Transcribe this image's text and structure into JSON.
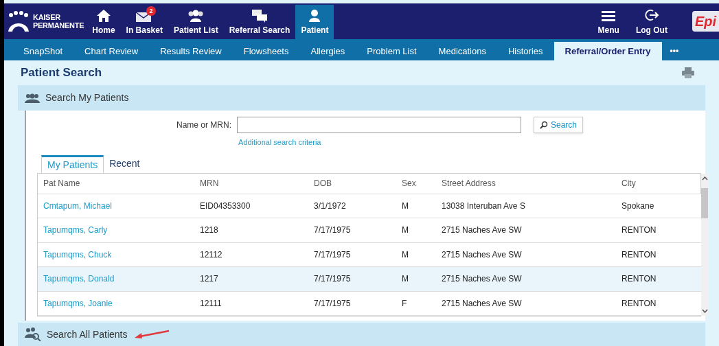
{
  "header": {
    "logo_text": [
      "KAISER",
      "PERMANENTE"
    ],
    "nav": [
      {
        "label": "Home",
        "selected": false
      },
      {
        "label": "In Basket",
        "badge": "2",
        "selected": false
      },
      {
        "label": "Patient List",
        "selected": false
      },
      {
        "label": "Referral Search",
        "selected": false
      },
      {
        "label": "Patient",
        "selected": true
      }
    ],
    "right_nav": [
      {
        "label": "Menu"
      },
      {
        "label": "Log Out"
      }
    ],
    "brand": "Epi"
  },
  "activity_tabs": [
    {
      "label": "SnapShot",
      "selected": false
    },
    {
      "label": "Chart Review",
      "selected": false
    },
    {
      "label": "Results Review",
      "selected": false
    },
    {
      "label": "Flowsheets",
      "selected": false
    },
    {
      "label": "Allergies",
      "selected": false
    },
    {
      "label": "Problem List",
      "selected": false
    },
    {
      "label": "Medications",
      "selected": false
    },
    {
      "label": "Histories",
      "selected": false
    },
    {
      "label": "Referral/Order Entry",
      "selected": true
    }
  ],
  "more": "•••",
  "page_title": "Patient Search",
  "my_patients_section": {
    "title": "Search My Patients",
    "field_label": "Name or MRN:",
    "search_button": "Search",
    "link": "Additional search criteria",
    "tabs": [
      {
        "label": "My Patients",
        "selected": true
      },
      {
        "label": "Recent",
        "selected": false
      }
    ],
    "table": {
      "columns": [
        "Pat Name",
        "MRN",
        "DOB",
        "Sex",
        "Street Address",
        "City"
      ],
      "rows": [
        {
          "cells": [
            "Cmtapum, Michael",
            "EID04353300",
            "3/1/1972",
            "M",
            "13038 Interuban Ave S",
            "Spokane"
          ],
          "selected": false
        },
        {
          "cells": [
            "Tapumqms, Carly",
            "1218",
            "7/17/1975",
            "M",
            "2715 Naches Ave SW",
            "RENTON"
          ],
          "selected": false
        },
        {
          "cells": [
            "Tapumqms, Chuck",
            "12112",
            "7/17/1975",
            "M",
            "2715 Naches Ave SW",
            "RENTON"
          ],
          "selected": false
        },
        {
          "cells": [
            "Tapumqms, Donald",
            "1217",
            "7/17/1975",
            "M",
            "2715 Naches Ave SW",
            "RENTON"
          ],
          "selected": true
        },
        {
          "cells": [
            "Tapumqms, Joanie",
            "12111",
            "7/17/1975",
            "F",
            "2715 Naches Ave SW",
            "RENTON"
          ],
          "selected": false
        }
      ]
    }
  },
  "all_patients_section": {
    "title": "Search All Patients"
  }
}
